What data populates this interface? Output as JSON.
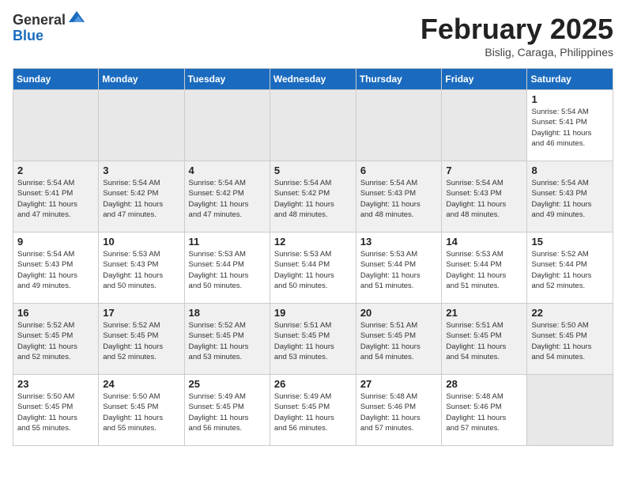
{
  "logo": {
    "general": "General",
    "blue": "Blue"
  },
  "title": "February 2025",
  "location": "Bislig, Caraga, Philippines",
  "weekdays": [
    "Sunday",
    "Monday",
    "Tuesday",
    "Wednesday",
    "Thursday",
    "Friday",
    "Saturday"
  ],
  "weeks": [
    [
      {
        "day": null,
        "info": null
      },
      {
        "day": null,
        "info": null
      },
      {
        "day": null,
        "info": null
      },
      {
        "day": null,
        "info": null
      },
      {
        "day": null,
        "info": null
      },
      {
        "day": null,
        "info": null
      },
      {
        "day": "1",
        "info": "Sunrise: 5:54 AM\nSunset: 5:41 PM\nDaylight: 11 hours\nand 46 minutes."
      }
    ],
    [
      {
        "day": "2",
        "info": "Sunrise: 5:54 AM\nSunset: 5:41 PM\nDaylight: 11 hours\nand 47 minutes."
      },
      {
        "day": "3",
        "info": "Sunrise: 5:54 AM\nSunset: 5:42 PM\nDaylight: 11 hours\nand 47 minutes."
      },
      {
        "day": "4",
        "info": "Sunrise: 5:54 AM\nSunset: 5:42 PM\nDaylight: 11 hours\nand 47 minutes."
      },
      {
        "day": "5",
        "info": "Sunrise: 5:54 AM\nSunset: 5:42 PM\nDaylight: 11 hours\nand 48 minutes."
      },
      {
        "day": "6",
        "info": "Sunrise: 5:54 AM\nSunset: 5:43 PM\nDaylight: 11 hours\nand 48 minutes."
      },
      {
        "day": "7",
        "info": "Sunrise: 5:54 AM\nSunset: 5:43 PM\nDaylight: 11 hours\nand 48 minutes."
      },
      {
        "day": "8",
        "info": "Sunrise: 5:54 AM\nSunset: 5:43 PM\nDaylight: 11 hours\nand 49 minutes."
      }
    ],
    [
      {
        "day": "9",
        "info": "Sunrise: 5:54 AM\nSunset: 5:43 PM\nDaylight: 11 hours\nand 49 minutes."
      },
      {
        "day": "10",
        "info": "Sunrise: 5:53 AM\nSunset: 5:43 PM\nDaylight: 11 hours\nand 50 minutes."
      },
      {
        "day": "11",
        "info": "Sunrise: 5:53 AM\nSunset: 5:44 PM\nDaylight: 11 hours\nand 50 minutes."
      },
      {
        "day": "12",
        "info": "Sunrise: 5:53 AM\nSunset: 5:44 PM\nDaylight: 11 hours\nand 50 minutes."
      },
      {
        "day": "13",
        "info": "Sunrise: 5:53 AM\nSunset: 5:44 PM\nDaylight: 11 hours\nand 51 minutes."
      },
      {
        "day": "14",
        "info": "Sunrise: 5:53 AM\nSunset: 5:44 PM\nDaylight: 11 hours\nand 51 minutes."
      },
      {
        "day": "15",
        "info": "Sunrise: 5:52 AM\nSunset: 5:44 PM\nDaylight: 11 hours\nand 52 minutes."
      }
    ],
    [
      {
        "day": "16",
        "info": "Sunrise: 5:52 AM\nSunset: 5:45 PM\nDaylight: 11 hours\nand 52 minutes."
      },
      {
        "day": "17",
        "info": "Sunrise: 5:52 AM\nSunset: 5:45 PM\nDaylight: 11 hours\nand 52 minutes."
      },
      {
        "day": "18",
        "info": "Sunrise: 5:52 AM\nSunset: 5:45 PM\nDaylight: 11 hours\nand 53 minutes."
      },
      {
        "day": "19",
        "info": "Sunrise: 5:51 AM\nSunset: 5:45 PM\nDaylight: 11 hours\nand 53 minutes."
      },
      {
        "day": "20",
        "info": "Sunrise: 5:51 AM\nSunset: 5:45 PM\nDaylight: 11 hours\nand 54 minutes."
      },
      {
        "day": "21",
        "info": "Sunrise: 5:51 AM\nSunset: 5:45 PM\nDaylight: 11 hours\nand 54 minutes."
      },
      {
        "day": "22",
        "info": "Sunrise: 5:50 AM\nSunset: 5:45 PM\nDaylight: 11 hours\nand 54 minutes."
      }
    ],
    [
      {
        "day": "23",
        "info": "Sunrise: 5:50 AM\nSunset: 5:45 PM\nDaylight: 11 hours\nand 55 minutes."
      },
      {
        "day": "24",
        "info": "Sunrise: 5:50 AM\nSunset: 5:45 PM\nDaylight: 11 hours\nand 55 minutes."
      },
      {
        "day": "25",
        "info": "Sunrise: 5:49 AM\nSunset: 5:45 PM\nDaylight: 11 hours\nand 56 minutes."
      },
      {
        "day": "26",
        "info": "Sunrise: 5:49 AM\nSunset: 5:45 PM\nDaylight: 11 hours\nand 56 minutes."
      },
      {
        "day": "27",
        "info": "Sunrise: 5:48 AM\nSunset: 5:46 PM\nDaylight: 11 hours\nand 57 minutes."
      },
      {
        "day": "28",
        "info": "Sunrise: 5:48 AM\nSunset: 5:46 PM\nDaylight: 11 hours\nand 57 minutes."
      },
      {
        "day": null,
        "info": null
      }
    ]
  ],
  "row_classes": [
    "row-white",
    "row-gray",
    "row-white",
    "row-gray",
    "row-white"
  ]
}
